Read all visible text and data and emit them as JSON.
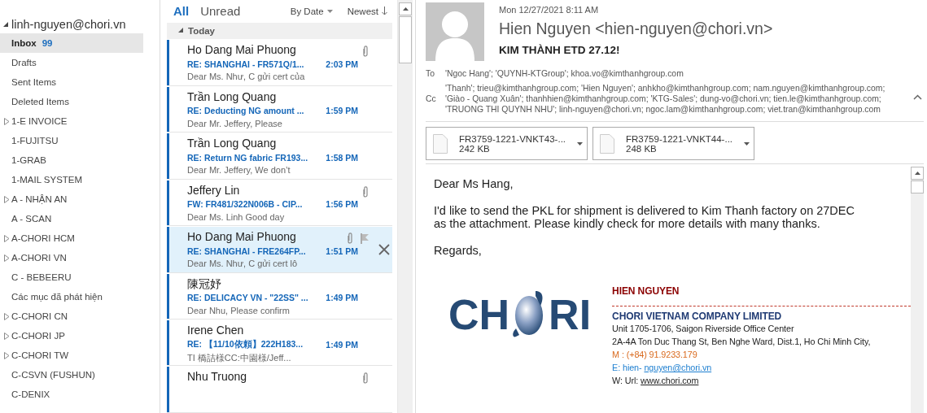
{
  "folder_pane": {
    "account": {
      "label": "linh-nguyen@chori.vn",
      "expanded": true
    },
    "folders": [
      {
        "label": "Inbox",
        "count": "99",
        "selected": true,
        "collapsed": false
      },
      {
        "label": "Drafts",
        "selected": false,
        "collapsed": false
      },
      {
        "label": "Sent Items",
        "selected": false,
        "collapsed": false
      },
      {
        "label": "Deleted Items",
        "selected": false,
        "collapsed": false
      },
      {
        "label": "1-E INVOICE",
        "selected": false,
        "collapsed": true
      },
      {
        "label": "1-FUJITSU",
        "selected": false,
        "collapsed": false
      },
      {
        "label": "1-GRAB",
        "selected": false,
        "collapsed": false
      },
      {
        "label": "1-MAIL SYSTEM",
        "selected": false,
        "collapsed": false
      },
      {
        "label": "A - NHẬN AN",
        "selected": false,
        "collapsed": true
      },
      {
        "label": "A - SCAN",
        "selected": false,
        "collapsed": false
      },
      {
        "label": "A-CHORI HCM",
        "selected": false,
        "collapsed": true
      },
      {
        "label": "A-CHORI VN",
        "selected": false,
        "collapsed": true
      },
      {
        "label": "C - BEBEERU",
        "selected": false,
        "collapsed": false
      },
      {
        "label": "Các mục đã phát hiện",
        "selected": false,
        "collapsed": false
      },
      {
        "label": "C-CHORI CN",
        "selected": false,
        "collapsed": true
      },
      {
        "label": "C-CHORI JP",
        "selected": false,
        "collapsed": true
      },
      {
        "label": "C-CHORI TW",
        "selected": false,
        "collapsed": true
      },
      {
        "label": "C-CSVN (FUSHUN)",
        "selected": false,
        "collapsed": false
      },
      {
        "label": "C-DENIX",
        "selected": false,
        "collapsed": false
      }
    ]
  },
  "message_list": {
    "filters": [
      {
        "label": "All",
        "selected": true
      },
      {
        "label": "Unread",
        "selected": false
      }
    ],
    "sort": "By Date",
    "order": "Newest",
    "group": {
      "label": "Today",
      "expanded": true
    },
    "messages": [
      {
        "sender": "Ho Dang Mai Phuong",
        "subject": "RE: SHANGHAI - FR571Q/1...",
        "time": "2:03 PM",
        "preview": "Dear Ms. Như,  C gửi cert của",
        "attachment": true,
        "unread": true,
        "selected": false
      },
      {
        "sender": "Trần Long Quang",
        "subject": "RE: Deducting NG amount ...",
        "time": "1:59 PM",
        "preview": "Dear Mr. Jeffery,  Please",
        "attachment": false,
        "unread": true,
        "selected": false
      },
      {
        "sender": "Trần Long Quang",
        "subject": "RE: Return NG fabric FR193...",
        "time": "1:58 PM",
        "preview": "Dear Mr. Jeffery,  We don’t",
        "attachment": false,
        "unread": true,
        "selected": false
      },
      {
        "sender": "Jeffery Lin",
        "subject": "FW: FR481/322N006B - CIP...",
        "time": "1:56 PM",
        "preview": "Dear Ms. Linh   Good day",
        "attachment": true,
        "unread": true,
        "selected": false
      },
      {
        "sender": "Ho Dang Mai Phuong",
        "subject": "RE: SHANGHAI - FRE264FP...",
        "time": "1:51 PM",
        "preview": "Dear Ms. Như,  C gửi cert lô",
        "attachment": true,
        "unread": true,
        "selected": true
      },
      {
        "sender": "陳冠妤",
        "subject": "RE: DELICACY VN - \"22SS\"  ...",
        "time": "1:49 PM",
        "preview": "Dear Nhu,  Please confirm",
        "attachment": false,
        "unread": true,
        "selected": false
      },
      {
        "sender": "Irene Chen",
        "subject": "RE: 【11/10依頼】222H183...",
        "time": "1:49 PM",
        "preview": "TI    橋詰様CC:中園様/Jeff...",
        "attachment": false,
        "unread": true,
        "selected": false
      },
      {
        "sender": "Nhu Truong",
        "attachment": true,
        "unread": true,
        "selected": false
      }
    ]
  },
  "reading_pane": {
    "date": "Mon 12/27/2021 8:11 AM",
    "from": "Hien Nguyen <hien-nguyen@chori.vn>",
    "subject": "KIM THÀNH ETD 27.12!",
    "to_label": "To",
    "to": "'Ngoc Hang'; 'QUYNH-KTGroup'; khoa.vo@kimthanhgroup.com",
    "cc_label": "Cc",
    "cc": [
      "'Thanh'; trieu@kimthanhgroup.com; 'Hien Nguyen'; anhkho@kimthanhgroup.com; nam.nguyen@kimthanhgroup.com;",
      "'Giào - Quang Xuân'; thanhhien@kimthanhgroup.com; 'KTG-Sales'; dung-vo@chori.vn; tien.le@kimthanhgroup.com;",
      "'TRUONG THI QUYNH NHU'; linh-nguyen@chori.vn; ngoc.lam@kimthanhgroup.com; viet.tran@kimthanhgroup.com"
    ],
    "attachments": [
      {
        "name": "FR3759-1221-VNKT43-...",
        "size": "242 KB"
      },
      {
        "name": "FR3759-1221-VNKT44-...",
        "size": "248 KB"
      }
    ],
    "body": {
      "greeting": "Dear Ms Hang,",
      "paragraph": [
        "I'd like to send the PKL for shipment is delivered to Kim Thanh factory on 27DEC",
        "as the attachment. Please kindly check for more details with many thanks."
      ],
      "closing": "Regards,"
    },
    "signature": {
      "logo": {
        "left": "CH",
        "right": "RI"
      },
      "name": "HIEN NGUYEN",
      "company": "CHORI VIETNAM COMPANY LIMITED",
      "address": [
        "Unit 1705-1706, Saigon Riverside Office Center",
        "2A-4A Ton Duc Thang St, Ben Nghe Ward, Dist.1, Ho Chi Minh City,"
      ],
      "mobile": "M : (+84) 91.9233.179",
      "email_label": "E: hien-",
      "email_link": "nguyen@chori.vn",
      "web_label": "W: Url:",
      "web_link": "www.chori.com"
    }
  }
}
